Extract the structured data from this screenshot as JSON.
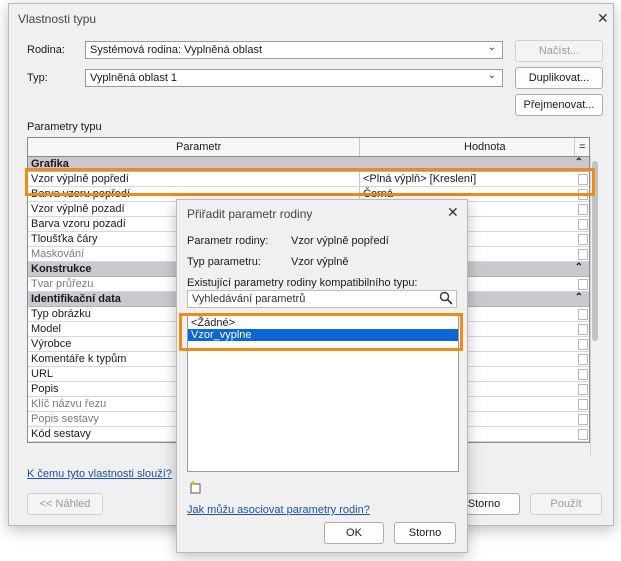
{
  "main": {
    "title": "Vlastnosti typu",
    "family_label": "Rodina:",
    "family_value": "Systémová rodina: Vyplněná oblast",
    "type_label": "Typ:",
    "type_value": "Vyplněná oblast 1",
    "load_button": "Načíst...",
    "duplicate_button": "Duplikovat...",
    "rename_button": "Přejmenovat...",
    "params_label": "Parametry typu",
    "col_parameter": "Parametr",
    "col_value": "Hodnota",
    "col_eq": "=",
    "rows": [
      {
        "label": "Grafika",
        "value": "",
        "group": true
      },
      {
        "label": "Vzor výplně popředí",
        "value": "<Plná výplň> [Kreslení]"
      },
      {
        "label": "Barva vzoru popředí",
        "value": "Černá"
      },
      {
        "label": "Vzor výplně pozadí",
        "value": ""
      },
      {
        "label": "Barva vzoru pozadí",
        "value": ""
      },
      {
        "label": "Tloušťka čáry",
        "value": ""
      },
      {
        "label": "Maskování",
        "value": "",
        "gray": true
      },
      {
        "label": "Konstrukce",
        "value": "",
        "group": true
      },
      {
        "label": "Tvar průřezu",
        "value": "",
        "gray": true
      },
      {
        "label": "Identifikační data",
        "value": "",
        "group": true
      },
      {
        "label": "Typ obrázku",
        "value": ""
      },
      {
        "label": "Model",
        "value": ""
      },
      {
        "label": "Výrobce",
        "value": ""
      },
      {
        "label": "Komentáře k typům",
        "value": ""
      },
      {
        "label": "URL",
        "value": ""
      },
      {
        "label": "Popis",
        "value": ""
      },
      {
        "label": "Klíč názvu řezu",
        "value": "",
        "gray": true
      },
      {
        "label": "Popis sestavy",
        "value": "",
        "gray": true
      },
      {
        "label": "Kód sestavy",
        "value": ""
      }
    ],
    "help_link": "K čemu tyto vlastnosti slouží?",
    "preview_button": "<< Náhled",
    "cancel_button": "Storno",
    "apply_button": "Použít"
  },
  "assoc": {
    "title": "Přiřadit parametr rodiny",
    "family_param_label": "Parametr rodiny:",
    "family_param_value": "Vzor výplně popředí",
    "param_type_label": "Typ parametru:",
    "param_type_value": "Vzor výplně",
    "existing_label": "Existující parametry rodiny kompatibilního typu:",
    "search_placeholder": "Vyhledávání parametrů",
    "list": [
      "<Žádné>",
      "Vzor_vyplne"
    ],
    "selected_index": 1,
    "help_link": "Jak můžu asociovat parametry rodin?",
    "ok_button": "OK",
    "cancel_button": "Storno"
  },
  "colors": {
    "highlight": "#f08a1a",
    "selection": "#0a66d1",
    "group_row": "#c9c9cf"
  }
}
